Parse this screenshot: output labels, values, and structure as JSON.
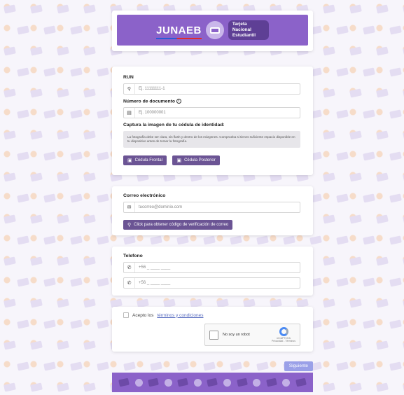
{
  "header": {
    "logo_text": "JUNAEB",
    "badge_text": "Tarjeta Nacional Estudiantil",
    "brand_color": "#8b62c9"
  },
  "identity": {
    "run_label": "RUN",
    "run_placeholder": "Ej. 11111111-1",
    "doc_label": "Número de documento",
    "doc_placeholder": "Ej. 100000001",
    "capture_label": "Captura la imagen de tu cédula de identidad:",
    "note_text": "La fotografía debe ser clara, sin flash y dentro de los márgenes. Comprueba si tienes suficiente espacio disponible en tu dispositivo antes de tomar la fotografía.",
    "front_button": "Cédula Frontal",
    "back_button": "Cédula Posterior"
  },
  "email": {
    "label": "Correo electrónico",
    "placeholder": "tucorreo@dominio.com",
    "verify_button": "Click para obtener código de verificación de correo"
  },
  "phone": {
    "label": "Telefono",
    "field1_value": "+56 _ ____ ____",
    "field2_value": "+56 _ ____ ____"
  },
  "terms": {
    "prefix": "Acepto los",
    "link": "términos y condiciones"
  },
  "captcha": {
    "label": "No soy un robot",
    "brand": "reCAPTCHA",
    "links": "Privacidad - Términos"
  },
  "actions": {
    "next_label": "Siguiente",
    "next_color": "#9aa0e8"
  }
}
